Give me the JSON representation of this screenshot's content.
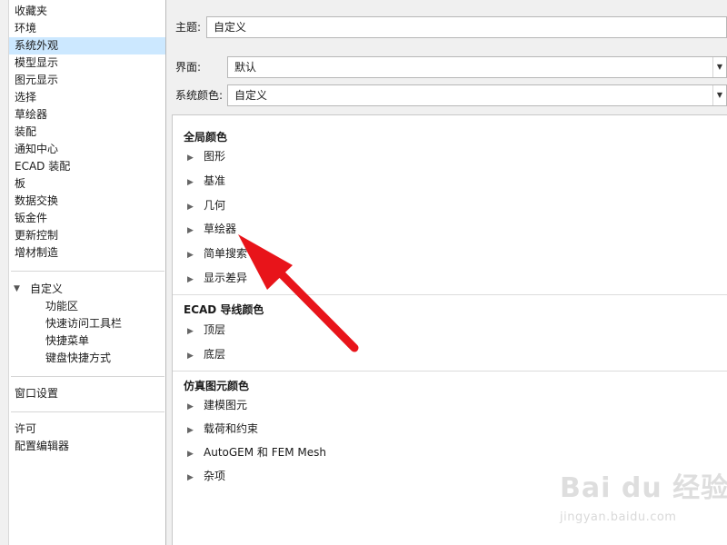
{
  "nav": {
    "items": [
      "收藏夹",
      "环境",
      "系统外观",
      "模型显示",
      "图元显示",
      "选择",
      "草绘器",
      "装配",
      "通知中心",
      "ECAD 装配",
      "板",
      "数据交换",
      "钣金件",
      "更新控制",
      "增材制造"
    ],
    "selected_index": 2,
    "customize": {
      "label": "自定义",
      "children": [
        "功能区",
        "快速访问工具栏",
        "快捷菜单",
        "键盘快捷方式"
      ]
    },
    "window_settings": "窗口设置",
    "license": "许可",
    "config_editor": "配置编辑器"
  },
  "theme": {
    "label": "主题:",
    "value": "自定义"
  },
  "interface": {
    "label": "界面:",
    "value": "默认"
  },
  "system_color": {
    "label": "系统颜色:",
    "value": "自定义"
  },
  "color_groups": {
    "global": {
      "title": "全局颜色",
      "items": [
        "图形",
        "基准",
        "几何",
        "草绘器",
        "简单搜索",
        "显示差异"
      ]
    },
    "ecad": {
      "title": "ECAD 导线颜色",
      "items": [
        "顶层",
        "底层"
      ]
    },
    "sim": {
      "title": "仿真图元颜色",
      "items": [
        "建模图元",
        "载荷和约束",
        "AutoGEM 和 FEM Mesh",
        "杂项"
      ]
    }
  },
  "annotation_arrow_color": "#e8141a",
  "watermark": {
    "brand": "Bai du 经验",
    "url": "jingyan.baidu.com"
  }
}
